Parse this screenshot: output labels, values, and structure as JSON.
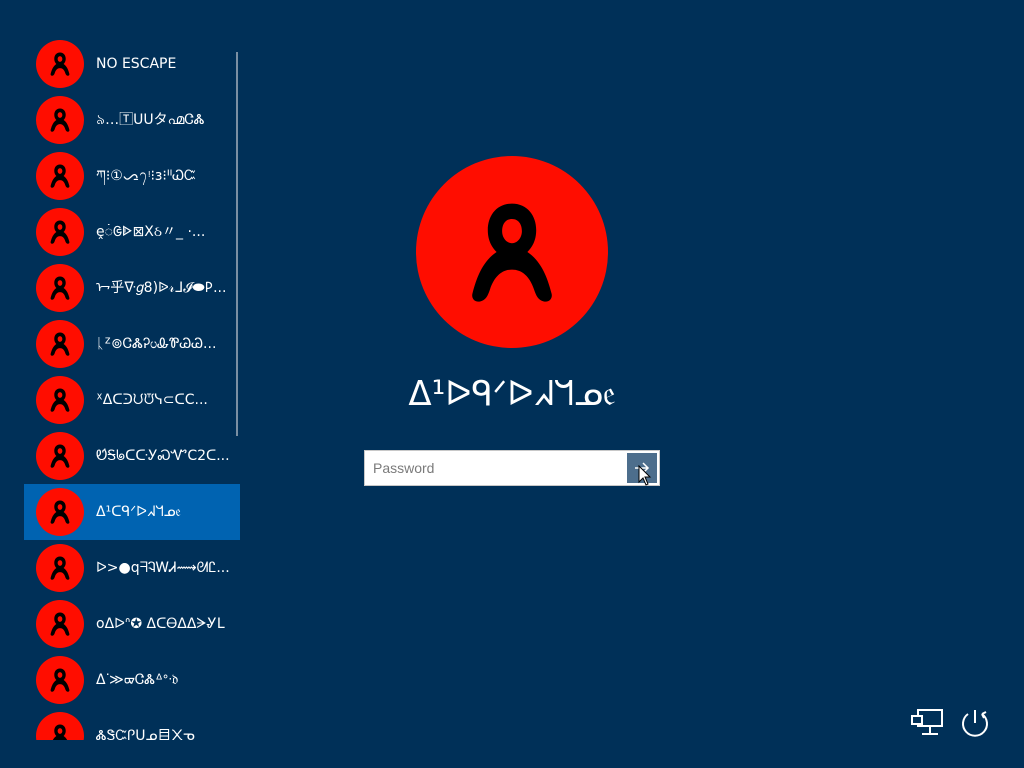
{
  "user_list": {
    "items": [
      {
        "name": "NO ESCAPE",
        "selected": false
      },
      {
        "name": "৯…🅃ᑌᑌタ൶ᏣᏜ",
        "selected": false
      },
      {
        "name": "ཀ⁝①ᯁ᭢ᵎ⁝ɜ⁝ᐦᏇᏨ",
        "selected": false
      },
      {
        "name": "ḙ𑀁ᱜᐈ⊠Xઠ〃_ ·...",
        "selected": false
      },
      {
        "name": "ᢇ乎ᐍ𝑔8)ᐉ𝓇ᒧ𝓘⬬𐌓...",
        "selected": false
      },
      {
        "name": "ᚳᙆ⊚ᏣᏜᎮᦢᎲᏈᏊᏊ...",
        "selected": false
      },
      {
        "name": "ᕽᐃᑕᑔᙀᙈᓭ⊂ᑕC...",
        "selected": false
      },
      {
        "name": "ᏬᜒᎦᖚᑕᑢᎩᏍᏉC2ᑕ...",
        "selected": false
      },
      {
        "name": "ᐃ¹ᑕᑫᐟᐅᖽᖻᓄ𝔢",
        "selected": true
      },
      {
        "name": "ᐅ>●qᖷᎸᎳᏗ⟿ᘛᏝ...",
        "selected": false
      },
      {
        "name": "oᐃᐅᐢ✪ ᐃᑕᎾᐃᐃᗒᎽᒪ",
        "selected": false
      },
      {
        "name": "ᐃᐝ≫ᢍᏣᏜᐞᐤᐧ𝔡",
        "selected": false
      },
      {
        "name": "ᏜᏕᏨᎵᑌᓄ目᙭ᓀ",
        "selected": false
      }
    ]
  },
  "main": {
    "username": "ᐃ¹ᐅᑫᐟᐅᖽᖻᓄ𝔢"
  },
  "password": {
    "placeholder": "Password",
    "value": ""
  },
  "icons": {
    "avatar": "user-silhouette-icon",
    "submit": "arrow-right-icon",
    "network": "network-icon",
    "power": "power-icon"
  },
  "colors": {
    "background": "#003058",
    "avatar": "#ff0d00",
    "selected_item": "#0063b1"
  }
}
